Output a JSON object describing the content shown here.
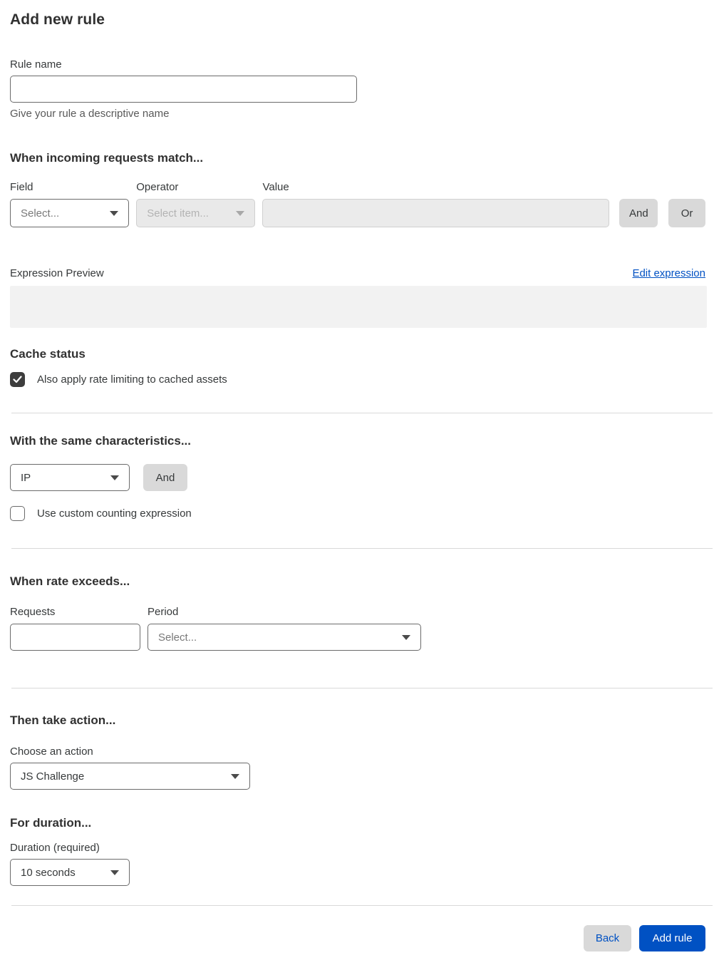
{
  "colors": {
    "accent_blue": "#0051c3",
    "divider": "#d9d9d9",
    "disabled_bg": "#e9e9e9",
    "preview_bg": "#f2f2f2",
    "gray_button_bg": "#d9d9d9",
    "checkbox_checked_bg": "#3d3d3d"
  },
  "header": {
    "title": "Add new rule"
  },
  "rule_name": {
    "label": "Rule name",
    "value": "",
    "helper": "Give your rule a descriptive name"
  },
  "match": {
    "heading": "When incoming requests match...",
    "field_label": "Field",
    "field_value": "Select...",
    "operator_label": "Operator",
    "operator_value": "Select item...",
    "value_label": "Value",
    "value_value": "",
    "and_label": "And",
    "or_label": "Or"
  },
  "expression": {
    "label": "Expression Preview",
    "edit_link": "Edit expression",
    "content": ""
  },
  "cache": {
    "heading": "Cache status",
    "checkbox_label": "Also apply rate limiting to cached assets",
    "checked": true
  },
  "characteristics": {
    "heading": "With the same characteristics...",
    "select_value": "IP",
    "and_label": "And",
    "counting_label": "Use custom counting expression",
    "counting_checked": false
  },
  "rate": {
    "heading": "When rate exceeds...",
    "requests_label": "Requests",
    "requests_value": "",
    "period_label": "Period",
    "period_value": "Select..."
  },
  "action": {
    "heading": "Then take action...",
    "choose_label": "Choose an action",
    "value": "JS Challenge"
  },
  "duration": {
    "heading": "For duration...",
    "label": "Duration (required)",
    "value": "10 seconds"
  },
  "footer": {
    "back": "Back",
    "add_rule": "Add rule"
  }
}
